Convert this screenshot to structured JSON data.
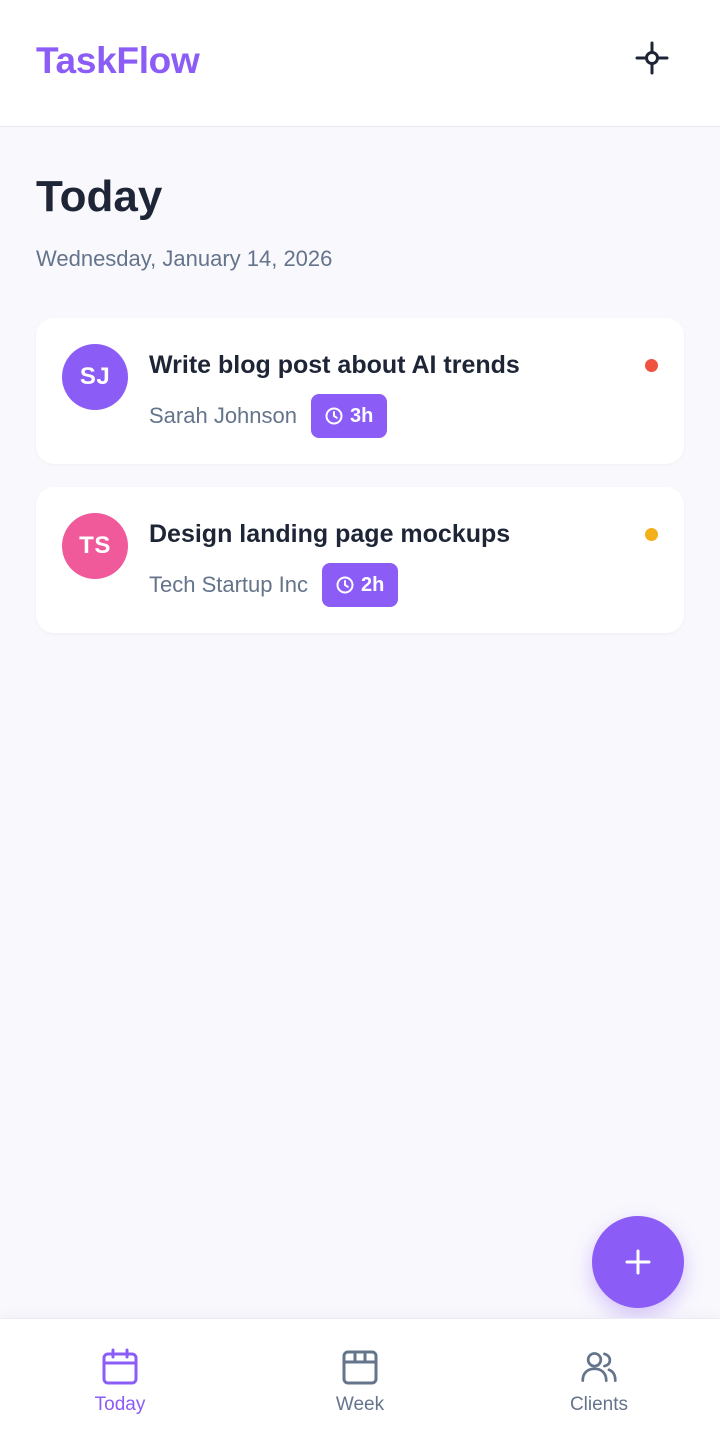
{
  "app": {
    "brand": "TaskFlow",
    "header_action_icon": "crosshair-icon"
  },
  "page": {
    "title": "Today",
    "date": "Wednesday, January 14, 2026"
  },
  "tasks": [
    {
      "initials": "SJ",
      "title": "Write blog post about AI trends",
      "client": "Sarah Johnson",
      "duration": "3h",
      "avatar_color": "#8b5cf6",
      "priority_color": "#ef5340"
    },
    {
      "initials": "TS",
      "title": "Design landing page mockups",
      "client": "Tech Startup Inc",
      "duration": "2h",
      "avatar_color": "#f05a9a",
      "priority_color": "#f4b01a"
    }
  ],
  "fab": {
    "icon": "plus-icon"
  },
  "nav": {
    "items": [
      {
        "label": "Today",
        "icon": "calendar-icon",
        "active": true
      },
      {
        "label": "Week",
        "icon": "calendar-week-icon",
        "active": false
      },
      {
        "label": "Clients",
        "icon": "users-icon",
        "active": false
      }
    ]
  },
  "colors": {
    "accent": "#8b5cf6",
    "text_primary": "#1e2536",
    "text_secondary": "#64748b",
    "background": "#f9f8fd"
  }
}
